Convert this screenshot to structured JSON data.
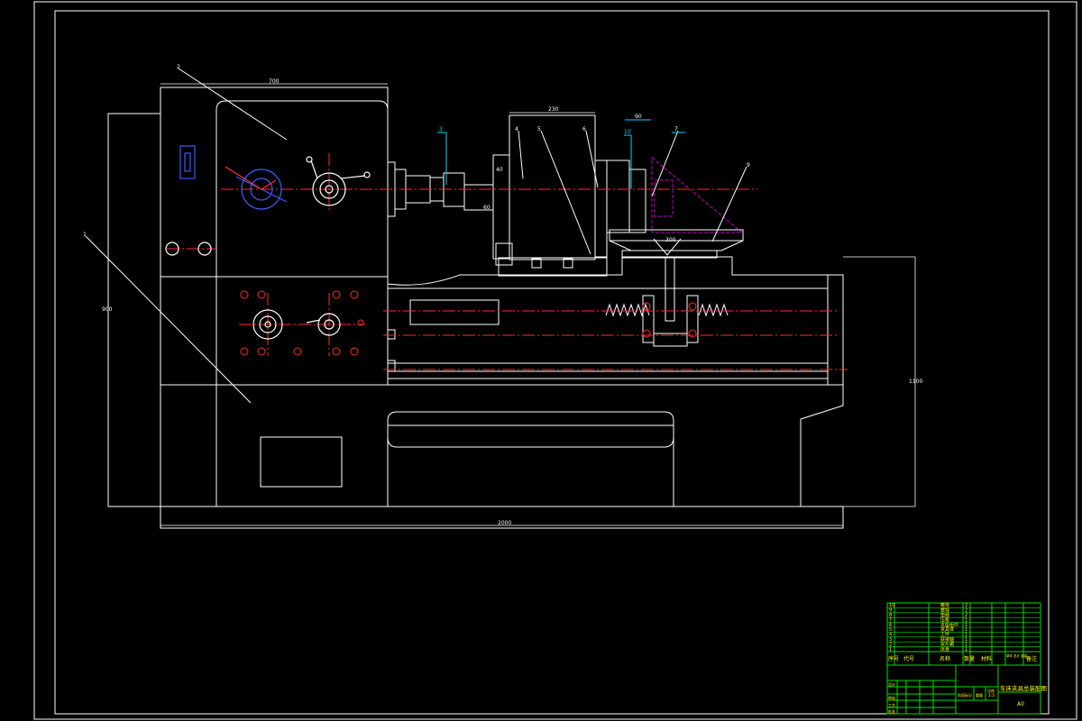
{
  "colors": {
    "background": "#000000",
    "outline": "#ffffff",
    "centerline": "#ff2a2a",
    "blue": "#3a5cff",
    "magenta": "#c400c4",
    "cyan": "#00d8ff",
    "title_block": "#00e000",
    "title_text": "#ffff00"
  },
  "drawing": {
    "leaders": [
      "1",
      "2",
      "3",
      "4",
      "5",
      "6",
      "7",
      "8",
      "9",
      "10"
    ],
    "dims": {
      "overall_length": "2000",
      "headstock_width": "700",
      "fixture_width": "230",
      "clamp_width": "90",
      "height_left": "900",
      "height_right": "1100",
      "small_a": "40",
      "small_b": "60",
      "base_len": "300"
    }
  },
  "title_block": {
    "bom_rows": [
      {
        "no": "10",
        "name": "螺母",
        "qty": "2"
      },
      {
        "no": "9",
        "name": "螺栓",
        "qty": "2"
      },
      {
        "no": "8",
        "name": "垫圈",
        "qty": "2"
      },
      {
        "no": "7",
        "name": "压板",
        "qty": "1"
      },
      {
        "no": "6",
        "name": "支座组件",
        "qty": "1"
      },
      {
        "no": "5",
        "name": "夹具体",
        "qty": "1"
      },
      {
        "no": "4",
        "name": "工件",
        "qty": "1"
      },
      {
        "no": "3",
        "name": "联接轴",
        "qty": "1"
      },
      {
        "no": "2",
        "name": "床头箱",
        "qty": "1"
      },
      {
        "no": "1",
        "name": "床身",
        "qty": "1"
      }
    ],
    "header": {
      "seq": "序号",
      "code": "代号",
      "name": "名称",
      "qty": "数量",
      "material": "材料",
      "weight": "单件 总计 重量",
      "remark": "备注"
    },
    "drawing_title": "车床夹具总装配图",
    "scale": "1:5",
    "sheet": "A0",
    "labels": {
      "design": "设计",
      "check": "审核",
      "process": "工艺",
      "approve": "批准",
      "stage": "阶段标记",
      "weight": "重量",
      "ratio": "比例"
    }
  }
}
